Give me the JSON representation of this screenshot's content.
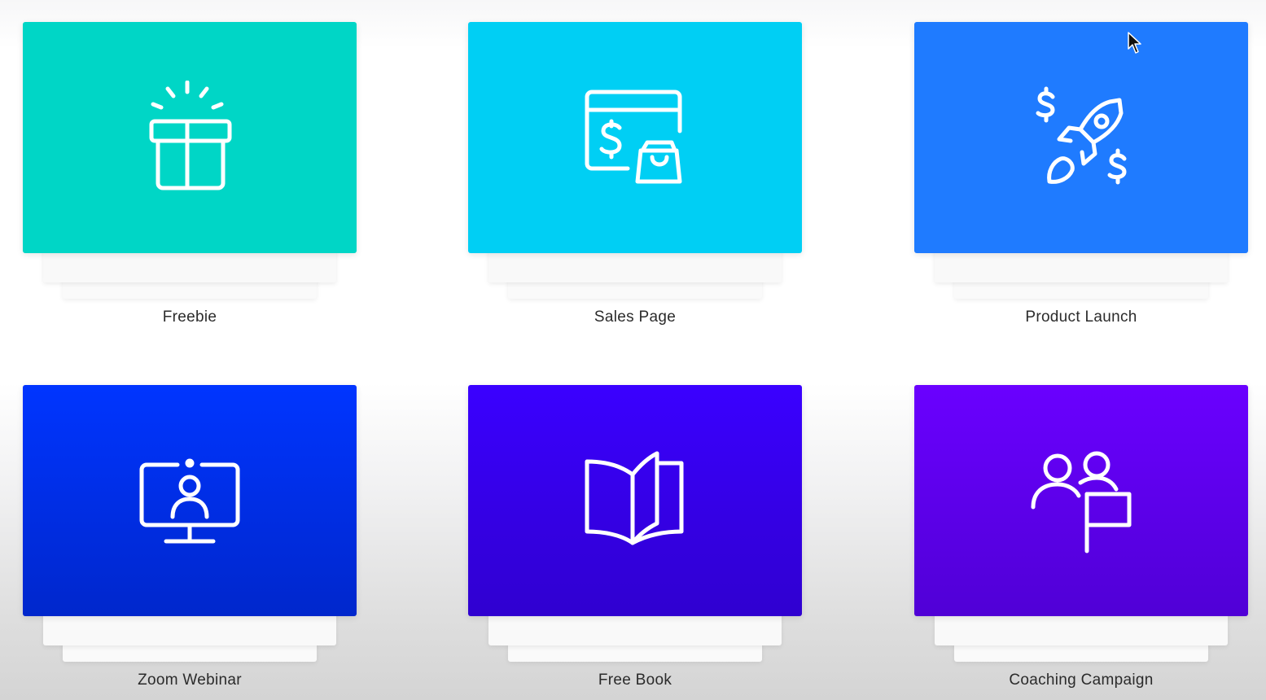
{
  "templates": [
    {
      "label": "Freebie",
      "icon": "gift-icon",
      "color": "#00d6c6"
    },
    {
      "label": "Sales Page",
      "icon": "sales-page-icon",
      "color": "#00cff4"
    },
    {
      "label": "Product Launch",
      "icon": "rocket-icon",
      "color": "#1f7bff"
    },
    {
      "label": "Zoom Webinar",
      "icon": "webinar-monitor-icon",
      "color": "#0030f0"
    },
    {
      "label": "Free Book",
      "icon": "open-book-icon",
      "color": "#3600f0"
    },
    {
      "label": "Coaching Campaign",
      "icon": "coaching-people-flag-icon",
      "color": "#6000f0"
    }
  ]
}
